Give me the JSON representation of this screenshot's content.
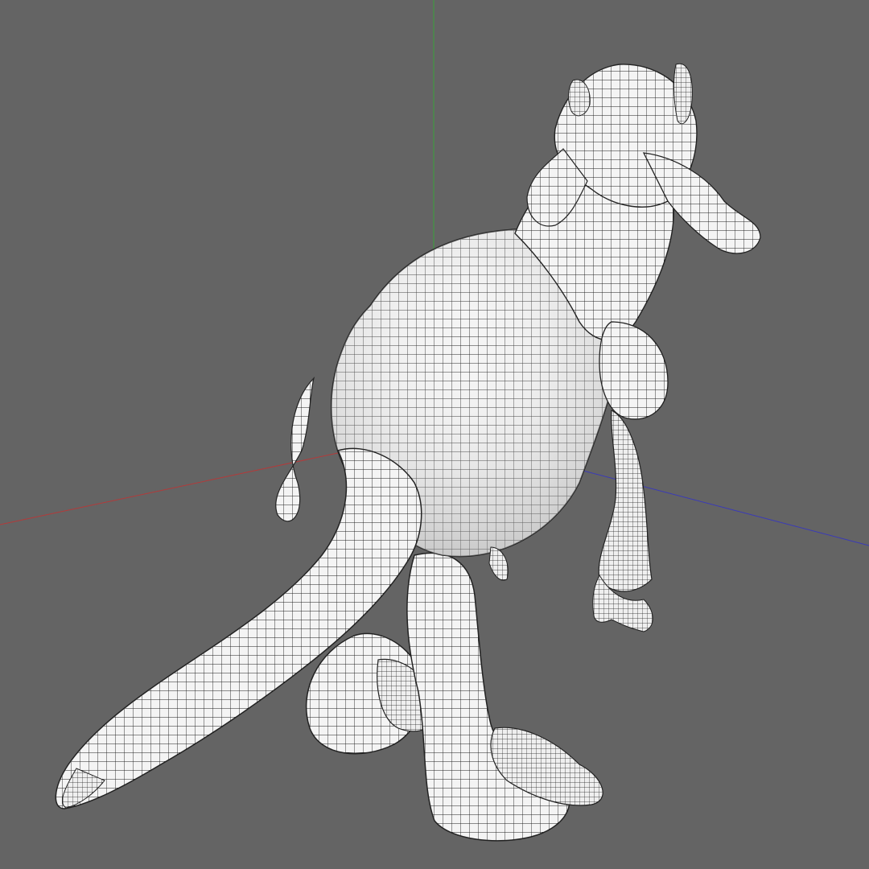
{
  "viewport": {
    "background": "#646464",
    "mode": "wireframe-on-shaded",
    "model": "dinosaur",
    "axes": {
      "x_color": "#b33a3a",
      "y_color": "#3aa23a",
      "z_color": "#3a3ab8"
    },
    "mesh": {
      "fill": "#f2f2f2",
      "wire": "#1e1e1e"
    }
  }
}
